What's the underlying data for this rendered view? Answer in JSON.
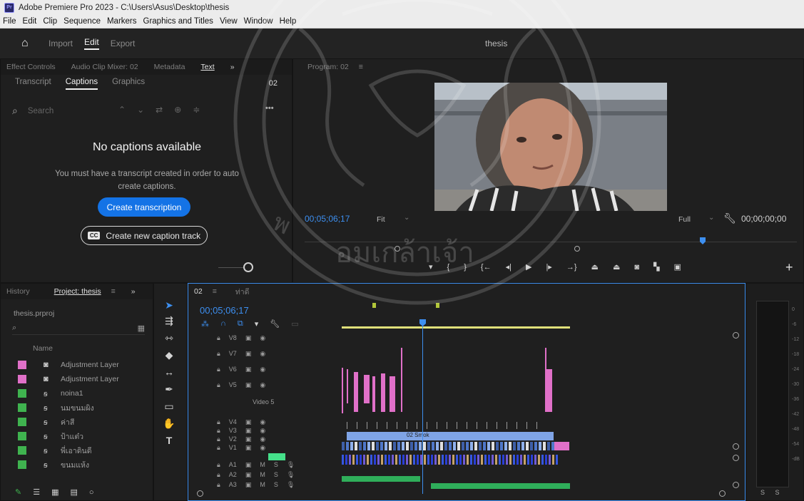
{
  "window": {
    "title": "Adobe Premiere Pro 2023 - C:\\Users\\Asus\\Desktop\\thesis",
    "badge": "Pr"
  },
  "menu": [
    "File",
    "Edit",
    "Clip",
    "Sequence",
    "Markers",
    "Graphics and Titles",
    "View",
    "Window",
    "Help"
  ],
  "workspace": {
    "tabs": [
      "Import",
      "Edit",
      "Export"
    ],
    "active": "Edit",
    "project_name": "thesis"
  },
  "text_panel": {
    "tabs": [
      "Effect Controls",
      "Audio Clip Mixer: 02",
      "Metadata",
      "Text",
      "»"
    ],
    "active_tab": "Text",
    "subtabs": [
      "Transcript",
      "Captions",
      "Graphics"
    ],
    "active_subtab": "Captions",
    "sequence": "02",
    "search_placeholder": "Search",
    "empty_title": "No captions available",
    "empty_desc": "You must have a transcript created in order to auto create captions.",
    "create_transcription": "Create transcription",
    "cc_badge": "CC",
    "create_caption_track": "Create new caption track"
  },
  "program": {
    "tab": "Program: 02",
    "timecode": "00;05;06;17",
    "fit": "Fit",
    "resolution": "Full",
    "duration": "00;00;00;00"
  },
  "project": {
    "tabs": [
      "History",
      "Project: thesis",
      "»"
    ],
    "file": "thesis.prproj",
    "column": "Name",
    "items": [
      {
        "name": "Adjustment Layer",
        "color": "#e070c8",
        "icon": "adjustment-layer-icon"
      },
      {
        "name": "Adjustment Layer",
        "color": "#e070c8",
        "icon": "adjustment-layer-icon"
      },
      {
        "name": "noina1",
        "color": "#3fb34f",
        "icon": "audio-video-icon"
      },
      {
        "name": "นมขนมผิง",
        "color": "#3fb34f",
        "icon": "audio-video-icon"
      },
      {
        "name": "ค่าสี",
        "color": "#3fb34f",
        "icon": "audio-video-icon"
      },
      {
        "name": "ป้าแต๋ว",
        "color": "#3fb34f",
        "icon": "audio-video-icon"
      },
      {
        "name": "พี่เอาดินดี",
        "color": "#3fb34f",
        "icon": "audio-video-icon"
      },
      {
        "name": "ขนมแห้ง",
        "color": "#3fb34f",
        "icon": "audio-video-icon"
      }
    ]
  },
  "timeline": {
    "tabs": [
      "02",
      "ท่าดี"
    ],
    "timecode": "00;05;06;17",
    "video_tracks": [
      "V8",
      "V7",
      "V6",
      "V5",
      "V4",
      "V3",
      "V2",
      "V1"
    ],
    "v5_name": "Video 5",
    "audio_tracks": [
      "A1",
      "A2",
      "A3"
    ],
    "clip_label": "02 Smok"
  },
  "meters": {
    "ticks": [
      "0",
      "-6",
      "-12",
      "-18",
      "-24",
      "-30",
      "-36",
      "-42",
      "-48",
      "-54",
      "-dB"
    ],
    "solo": [
      "S",
      "S"
    ]
  },
  "colors": {
    "accent": "#1473e6",
    "timecode": "#3d8ff0",
    "label_green": "#3fb34f",
    "label_pink": "#e070c8"
  }
}
